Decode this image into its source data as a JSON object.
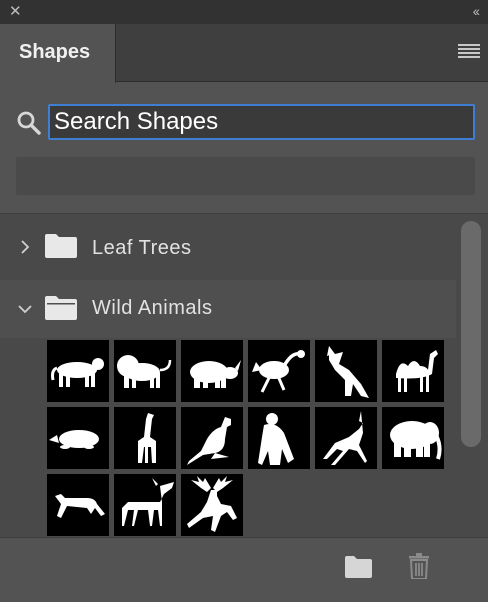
{
  "panel": {
    "tab_label": "Shapes"
  },
  "search": {
    "placeholder": "Search Shapes"
  },
  "groups": [
    {
      "label": "Leaf Trees",
      "expanded": false
    },
    {
      "label": "Wild Animals",
      "expanded": true
    }
  ],
  "shapes": [
    "tiger-shape",
    "lion-shape",
    "rhinoceros-shape",
    "ostrich-shape",
    "wolf-shape",
    "camel-shape",
    "mole-shape",
    "giraffe-shape",
    "kangaroo-shape",
    "gorilla-shape",
    "gazelle-shape",
    "elephant-shape",
    "cheetah-shape",
    "moose-shape",
    "reindeer-shape"
  ],
  "colors": {
    "panel_bg": "#535353",
    "list_bg": "#494949",
    "accent_focus": "#3e7fd3",
    "tile_bg": "#000000",
    "shape_fill": "#ffffff"
  },
  "icons": {
    "close": "close-icon",
    "collapse": "double-chevron-left-icon",
    "menu": "panel-menu-icon",
    "search": "search-icon",
    "folder": "folder-icon",
    "new_group": "new-group-folder-icon",
    "delete": "trash-icon"
  }
}
